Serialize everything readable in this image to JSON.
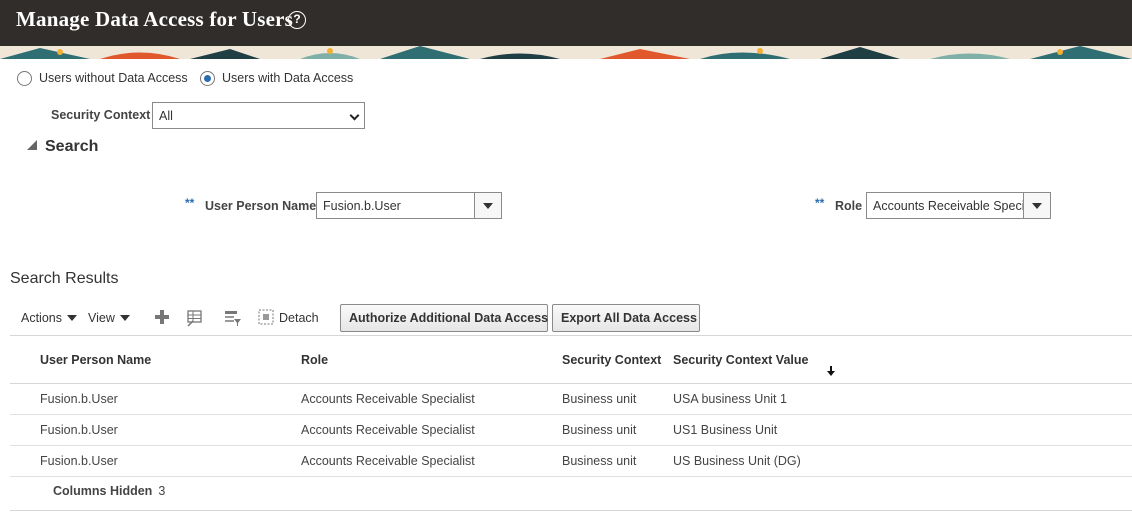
{
  "header": {
    "title": "Manage Data Access for Users",
    "help_glyph": "?"
  },
  "access_filter": {
    "options": [
      {
        "label": "Users without Data Access",
        "selected": false
      },
      {
        "label": "Users with Data Access",
        "selected": true
      }
    ]
  },
  "security_context": {
    "label": "Security Context",
    "value": "All"
  },
  "search": {
    "title": "Search",
    "fields": [
      {
        "label": "User Person Name",
        "value": "Fusion.b.User",
        "required_marker": "**"
      },
      {
        "label": "Role",
        "value": "Accounts Receivable Speci",
        "required_marker": "**"
      }
    ]
  },
  "results": {
    "title": "Search Results",
    "toolbar": {
      "actions_label": "Actions",
      "view_label": "View",
      "detach_label": "Detach",
      "authorize_label": "Authorize Additional Data Access",
      "export_label": "Export All Data Access"
    },
    "columns": [
      "User Person Name",
      "Role",
      "Security Context",
      "Security Context Value"
    ],
    "rows": [
      [
        "Fusion.b.User",
        "Accounts Receivable Specialist",
        "Business unit",
        "USA business Unit 1"
      ],
      [
        "Fusion.b.User",
        "Accounts Receivable Specialist",
        "Business unit",
        "US1 Business Unit"
      ],
      [
        "Fusion.b.User",
        "Accounts Receivable Specialist",
        "Business unit",
        "US Business Unit (DG)"
      ]
    ],
    "footer": {
      "label": "Columns Hidden",
      "count": "3"
    }
  },
  "colors": {
    "header_bg": "#312d2a",
    "radio_accent": "#2b6cb0"
  }
}
